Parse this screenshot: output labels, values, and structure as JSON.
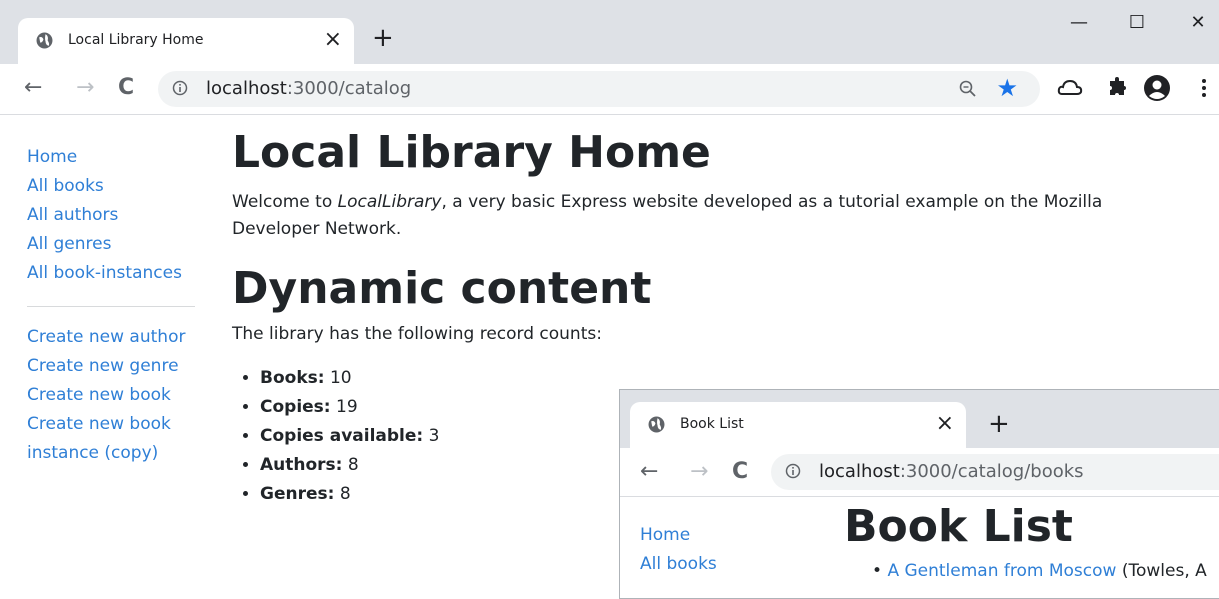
{
  "browser": {
    "tab_title": "Local Library Home",
    "tab_close": "×",
    "new_tab": "+",
    "url_prefix": "localhost",
    "url_suffix": ":3000/catalog",
    "minimize": "—",
    "maximize": "☐",
    "close": "✕",
    "back": "←",
    "forward": "→",
    "reload": "C",
    "star": "★"
  },
  "sidebar": {
    "items": [
      "Home",
      "All books",
      "All authors",
      "All genres",
      "All book-instances"
    ],
    "create_items": [
      "Create new author",
      "Create new genre",
      "Create new book",
      "Create new book",
      "instance (copy)"
    ]
  },
  "main": {
    "title": "Local Library Home",
    "welcome_pre": "Welcome to ",
    "welcome_em": "LocalLibrary",
    "welcome_post": ", a very basic Express website developed as a tutorial example on the Mozilla Developer Network.",
    "section_title": "Dynamic content",
    "counts_intro": "The library has the following record counts:",
    "counts": [
      {
        "label": "Books:",
        "value": "10"
      },
      {
        "label": "Copies:",
        "value": "19"
      },
      {
        "label": "Copies available:",
        "value": "3"
      },
      {
        "label": "Authors:",
        "value": "8"
      },
      {
        "label": "Genres:",
        "value": "8"
      }
    ]
  },
  "overlay": {
    "tab_title": "Book List",
    "tab_close": "×",
    "new_tab": "+",
    "url_prefix": "localhost",
    "url_suffix": ":3000/catalog/books",
    "back": "←",
    "forward": "→",
    "reload": "C",
    "sidebar": [
      "Home",
      "All books"
    ],
    "title": "Book List",
    "first_book": "A Gentleman from Moscow",
    "first_book_author": " (Towles, A"
  }
}
